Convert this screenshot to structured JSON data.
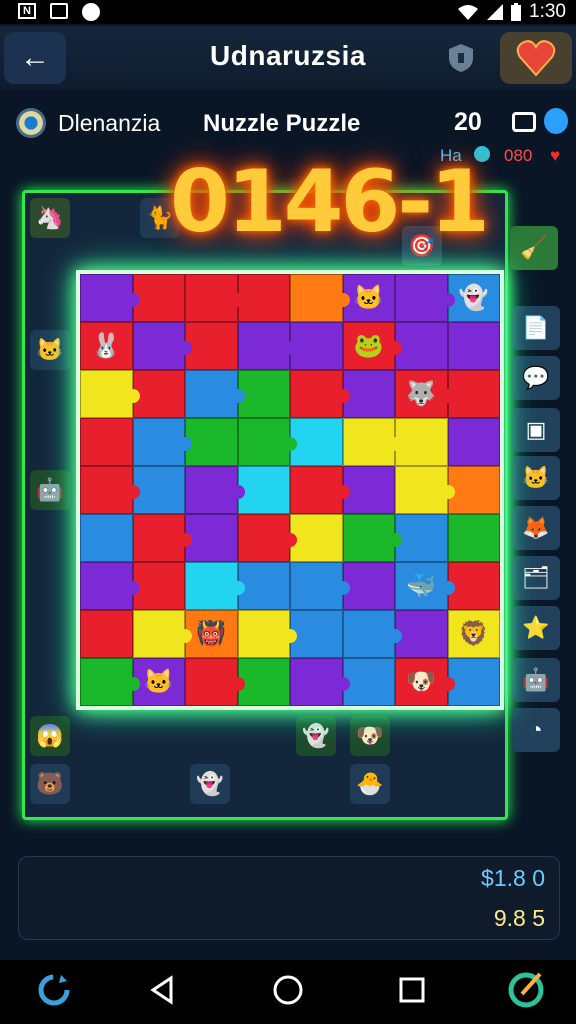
{
  "status_bar": {
    "left_icons": [
      "N",
      "image-icon",
      "record-dot-icon"
    ],
    "time": "1:30",
    "right_icons": [
      "wifi-icon",
      "signal-icon",
      "battery-icon"
    ]
  },
  "app_bar": {
    "title": "Udnaruzsia",
    "back_icon": "arrow-left-icon",
    "shield_icon": "shield-icon",
    "favorite_icon": "heart-icon"
  },
  "info": {
    "player_name": "Dlenanzia",
    "puzzle_title": "Nuzzle Puzzle",
    "score": "20",
    "sub_left": "Ha",
    "sub_right": "080"
  },
  "counter": "0146-1",
  "footer_panel": {
    "primary_amount": "$1.8 0",
    "secondary_amount": "9.8 5"
  },
  "nav": {
    "items": [
      "refresh-icon",
      "back-triangle-icon",
      "home-circle-icon",
      "recents-square-icon",
      "compass-icon"
    ]
  },
  "colors": {
    "board_glow": "#32e84a",
    "counter_glow": "#ff6a00",
    "piece_palette": [
      "#7b2ad6",
      "#e81f2c",
      "#f1e51e",
      "#1ab82a",
      "#2a8ce0",
      "#22d4f0",
      "#ff7a12"
    ]
  },
  "board": {
    "rows": [
      [
        "#7b2ad6",
        "#e81f2c",
        "#e81f2c",
        "#e81f2c",
        "#ff7a12",
        "#7b2ad6",
        "#7b2ad6",
        "#2a8ce0"
      ],
      [
        "#e81f2c",
        "#7b2ad6",
        "#e81f2c",
        "#7b2ad6",
        "#7b2ad6",
        "#e81f2c",
        "#7b2ad6",
        "#7b2ad6"
      ],
      [
        "#f1e51e",
        "#e81f2c",
        "#2a8ce0",
        "#1ab82a",
        "#e81f2c",
        "#7b2ad6",
        "#e81f2c",
        "#e81f2c"
      ],
      [
        "#e81f2c",
        "#2a8ce0",
        "#1ab82a",
        "#1ab82a",
        "#22d4f0",
        "#f1e51e",
        "#f1e51e",
        "#7b2ad6"
      ],
      [
        "#e81f2c",
        "#2a8ce0",
        "#7b2ad6",
        "#22d4f0",
        "#e81f2c",
        "#7b2ad6",
        "#f1e51e",
        "#ff7a12"
      ],
      [
        "#2a8ce0",
        "#e81f2c",
        "#7b2ad6",
        "#e81f2c",
        "#f1e51e",
        "#1ab82a",
        "#2a8ce0",
        "#1ab82a"
      ],
      [
        "#7b2ad6",
        "#e81f2c",
        "#22d4f0",
        "#2a8ce0",
        "#2a8ce0",
        "#7b2ad6",
        "#2a8ce0",
        "#e81f2c"
      ],
      [
        "#e81f2c",
        "#f1e51e",
        "#ff7a12",
        "#f1e51e",
        "#2a8ce0",
        "#2a8ce0",
        "#7b2ad6",
        "#f1e51e"
      ],
      [
        "#1ab82a",
        "#7b2ad6",
        "#e81f2c",
        "#1ab82a",
        "#7b2ad6",
        "#2a8ce0",
        "#e81f2c",
        "#2a8ce0"
      ]
    ]
  }
}
